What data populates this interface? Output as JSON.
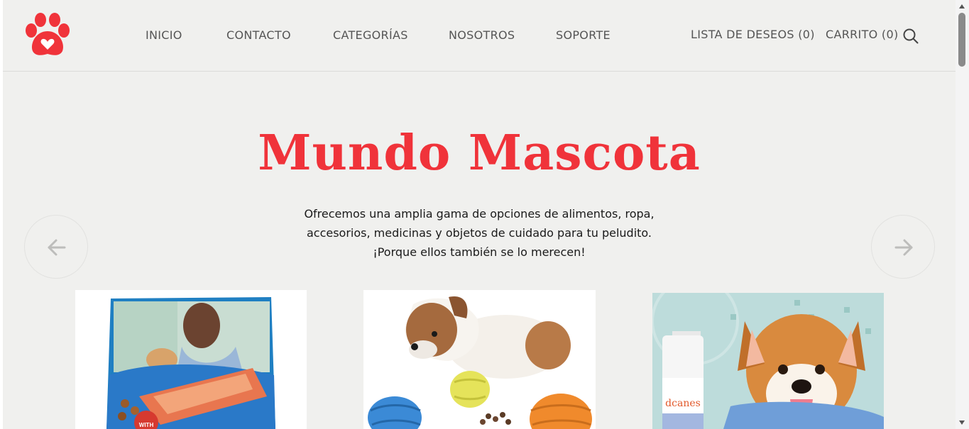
{
  "brand": {
    "logo_icon": "paw-heart-icon",
    "accent_color": "#f0333a"
  },
  "nav": {
    "items": [
      "INICIO",
      "CONTACTO",
      "CATEGORÍAS",
      "NOSOTROS",
      "SOPORTE"
    ],
    "wishlist": "LISTA DE DESEOS (0)",
    "cart": "CARRITO (0)",
    "search_icon": "search-icon"
  },
  "hero": {
    "title": "Mundo Mascota",
    "lines": [
      "Ofrecemos una amplia gama de opciones de alimentos, ropa,",
      "accesorios, medicinas y objetos de cuidado para tu peludito.",
      "¡Porque ellos también se lo merecen!"
    ]
  },
  "carousel": {
    "prev_icon": "arrow-left-icon",
    "next_icon": "arrow-right-icon"
  },
  "products": [
    {
      "image_label": "WITH"
    },
    {
      "image": "dog-with-toy-balls"
    },
    {
      "image_label": "dcanes"
    }
  ]
}
